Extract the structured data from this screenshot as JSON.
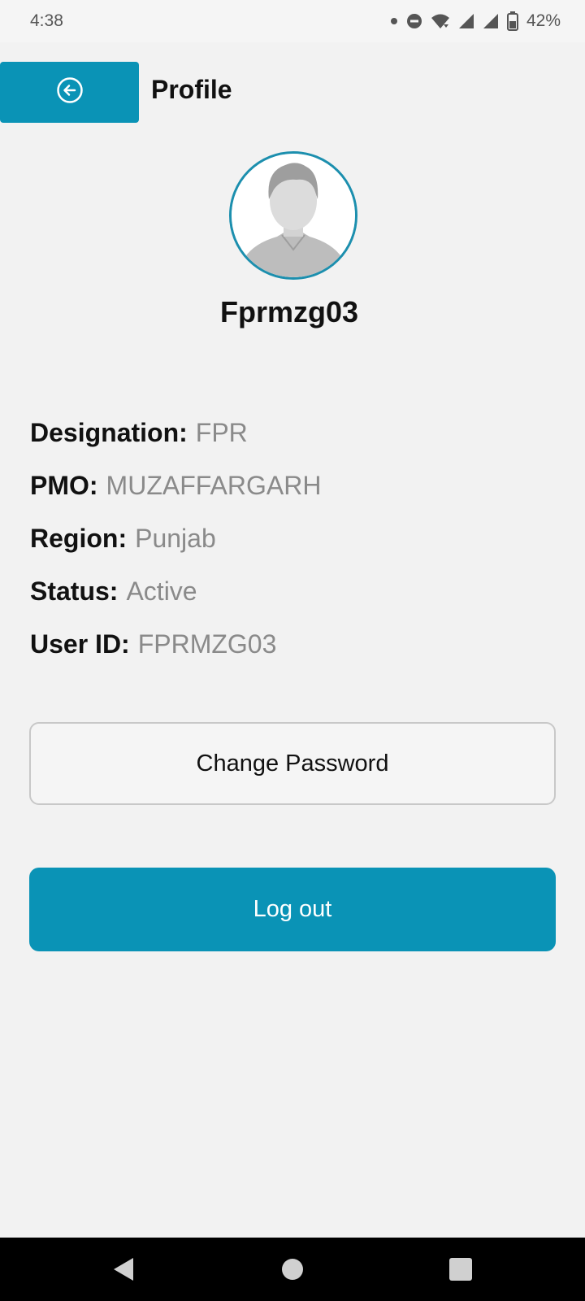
{
  "status_bar": {
    "time": "4:38",
    "battery": "42%"
  },
  "header": {
    "title": "Profile",
    "back_icon": "arrow-left-circle-icon"
  },
  "profile": {
    "avatar_icon": "default-user-avatar",
    "username": "Fprmzg03",
    "details": [
      {
        "label": "Designation:",
        "value": "FPR"
      },
      {
        "label": "PMO:",
        "value": "MUZAFFARGARH"
      },
      {
        "label": "Region:",
        "value": "Punjab"
      },
      {
        "label": "Status:",
        "value": "Active"
      },
      {
        "label": "User ID:",
        "value": "FPRMZG03"
      }
    ]
  },
  "actions": {
    "change_password_label": "Change Password",
    "logout_label": "Log out"
  },
  "colors": {
    "accent": "#0a93b6",
    "background": "#f2f2f2",
    "value_text": "#8a8a8a"
  }
}
